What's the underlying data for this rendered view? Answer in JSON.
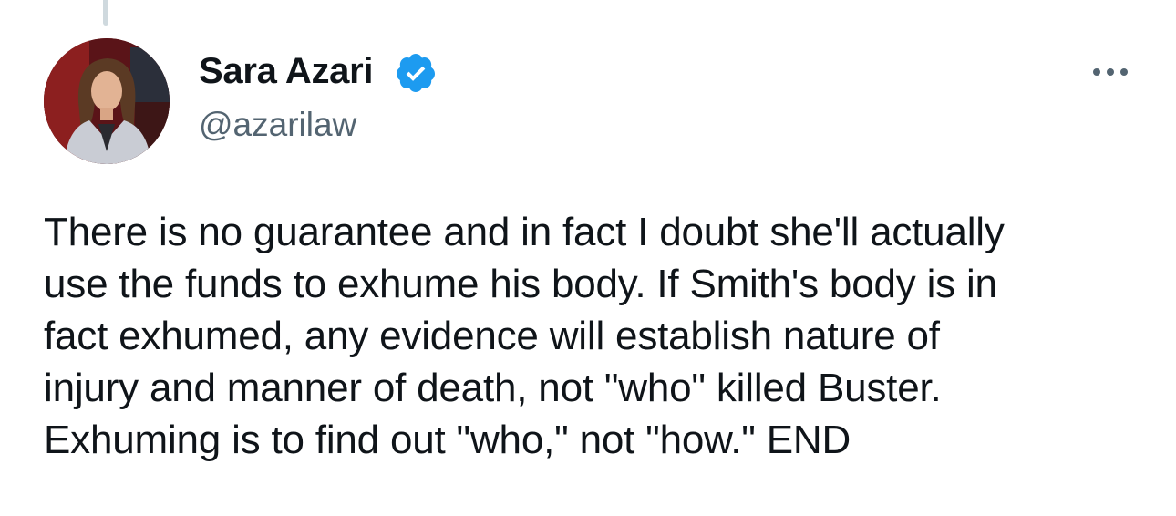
{
  "author": {
    "display_name": "Sara Azari",
    "handle": "@azarilaw",
    "verified": true
  },
  "tweet": {
    "lines": [
      "There is no guarantee and in fact I doubt she'll actually",
      "use the funds to exhume his body. If Smith's body is in",
      "fact exhumed, any evidence will establish nature of",
      "injury and manner of death, not \"who\" killed Buster.",
      "Exhuming is to find out \"who,\" not \"how.\" END"
    ]
  },
  "icons": {
    "verified": "verified-badge-icon",
    "more": "more-options-icon"
  },
  "colors": {
    "verified_blue": "#1d9bf0",
    "text_primary": "#0f1419",
    "text_secondary": "#536471",
    "thread_line": "#cfd9de"
  }
}
